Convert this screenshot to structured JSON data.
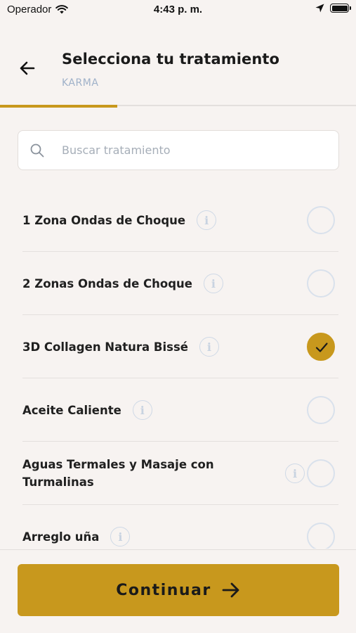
{
  "status_bar": {
    "carrier": "Operador",
    "time": "4:43 p. m.",
    "icons": [
      "wifi-icon",
      "location-arrow-icon",
      "battery-icon"
    ]
  },
  "header": {
    "title": "Selecciona tu tratamiento",
    "subtitle": "KARMA",
    "back_icon": "arrow-left-icon",
    "progress": 0.33
  },
  "search": {
    "placeholder": "Buscar tratamiento",
    "value": "",
    "icon": "search-icon"
  },
  "treatments": [
    {
      "label": "1 Zona Ondas de Choque",
      "selected": false
    },
    {
      "label": "2 Zonas Ondas de Choque",
      "selected": false
    },
    {
      "label": "3D Collagen Natura Bissé",
      "selected": true
    },
    {
      "label": "Aceite Caliente",
      "selected": false
    },
    {
      "label": "Aguas Termales y Masaje con Turmalinas",
      "selected": false
    },
    {
      "label": "Arreglo uña",
      "selected": false
    }
  ],
  "info_glyph": "i",
  "footer": {
    "continue_label": "Continuar",
    "continue_icon": "arrow-right-icon"
  },
  "colors": {
    "accent": "#c8981d",
    "background": "#f7f3f1",
    "subtitle": "#9fb1c9",
    "radio_border": "#d9e1ec"
  }
}
